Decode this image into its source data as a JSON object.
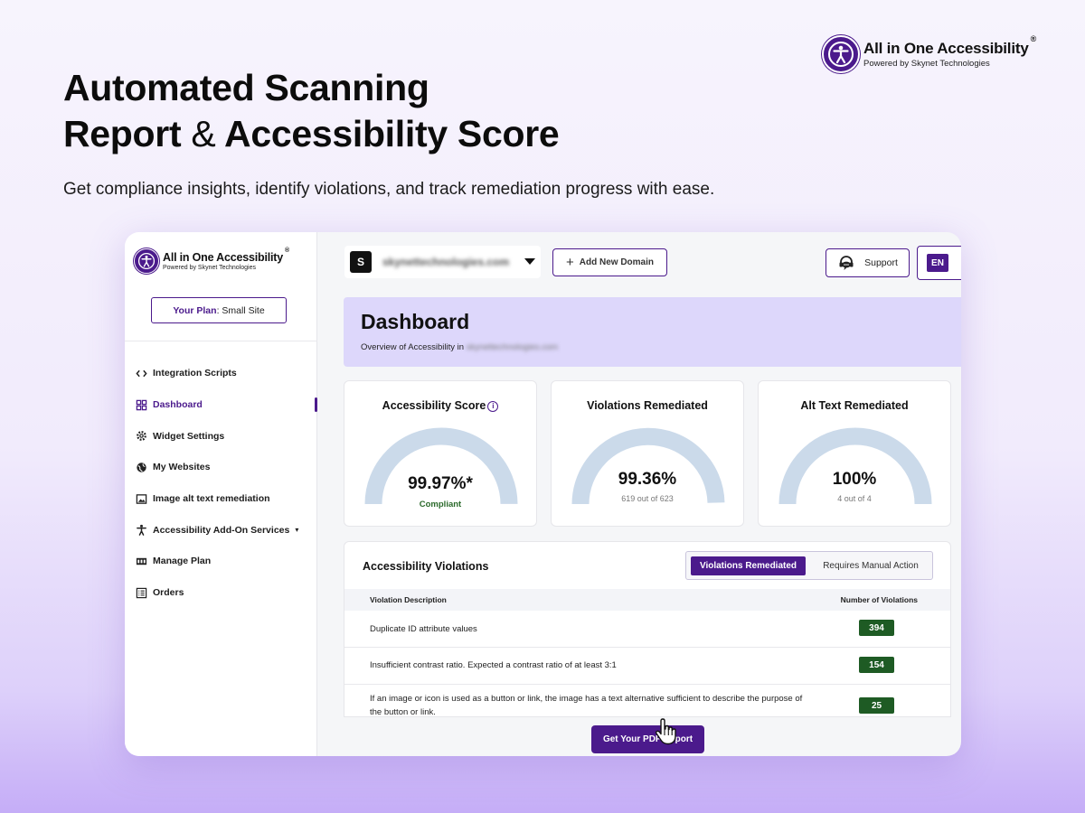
{
  "brand": {
    "name": "All in One Accessibility",
    "registered": "®",
    "tagline": "Powered by Skynet Technologies"
  },
  "hero": {
    "title_line1": "Automated Scanning",
    "title_line2_a": "Report",
    "title_amp": "&",
    "title_line2_b": "Accessibility Score",
    "subtitle": "Get compliance insights, identify violations, and track remediation progress with ease."
  },
  "sidebar": {
    "plan_label": "Your Plan",
    "plan_value": ": Small Site",
    "items": [
      {
        "label": "Integration Scripts",
        "icon": "code-icon"
      },
      {
        "label": "Dashboard",
        "icon": "grid-icon",
        "active": true
      },
      {
        "label": "Widget Settings",
        "icon": "gear-icon"
      },
      {
        "label": "My Websites",
        "icon": "globe-icon"
      },
      {
        "label": "Image alt text remediation",
        "icon": "image-icon"
      },
      {
        "label": "Accessibility Add-On Services",
        "icon": "person-icon",
        "caret": "▾"
      },
      {
        "label": "Manage Plan",
        "icon": "plan-icon"
      },
      {
        "label": "Orders",
        "icon": "list-icon"
      }
    ]
  },
  "topbar": {
    "domain_initial": "S",
    "domain_name": "skynettechnologies.com",
    "add_domain_label": "Add New Domain",
    "support_label": "Support",
    "lang_label": "EN"
  },
  "dashboard": {
    "title": "Dashboard",
    "subtitle_prefix": "Overview of Accessibility in",
    "subtitle_domain": "skynettechnologies.com"
  },
  "stats": {
    "score": {
      "label": "Accessibility Score",
      "info": "i",
      "value": "99.97%*",
      "note": "Compliant",
      "fraction": 0.9997
    },
    "violations": {
      "label": "Violations Remediated",
      "value": "99.36%",
      "note": "619 out of 623",
      "fraction": 0.9936
    },
    "alt_text": {
      "label": "Alt Text Remediated",
      "value": "100%",
      "note": "4 out of 4",
      "fraction": 1.0
    }
  },
  "violations_table": {
    "title": "Accessibility Violations",
    "tab_active": "Violations Remediated",
    "tab_other": "Requires Manual Action",
    "col_desc": "Violation Description",
    "col_num": "Number of Violations",
    "rows": [
      {
        "desc": "Duplicate ID attribute values",
        "count": "394"
      },
      {
        "desc": "Insufficient contrast ratio. Expected a contrast ratio of at least 3:1",
        "count": "154"
      },
      {
        "desc": "If an image or icon is used as a button or link, the image has a text alternative sufficient to describe the purpose of the button or link.",
        "count": "25"
      }
    ]
  },
  "pdf_button": "Get Your PDF Report",
  "colors": {
    "brand_purple": "#4b1a8c",
    "gauge_track": "#cbdaea",
    "badge_green": "#1e5b24",
    "banner": "#ddd7fb"
  }
}
